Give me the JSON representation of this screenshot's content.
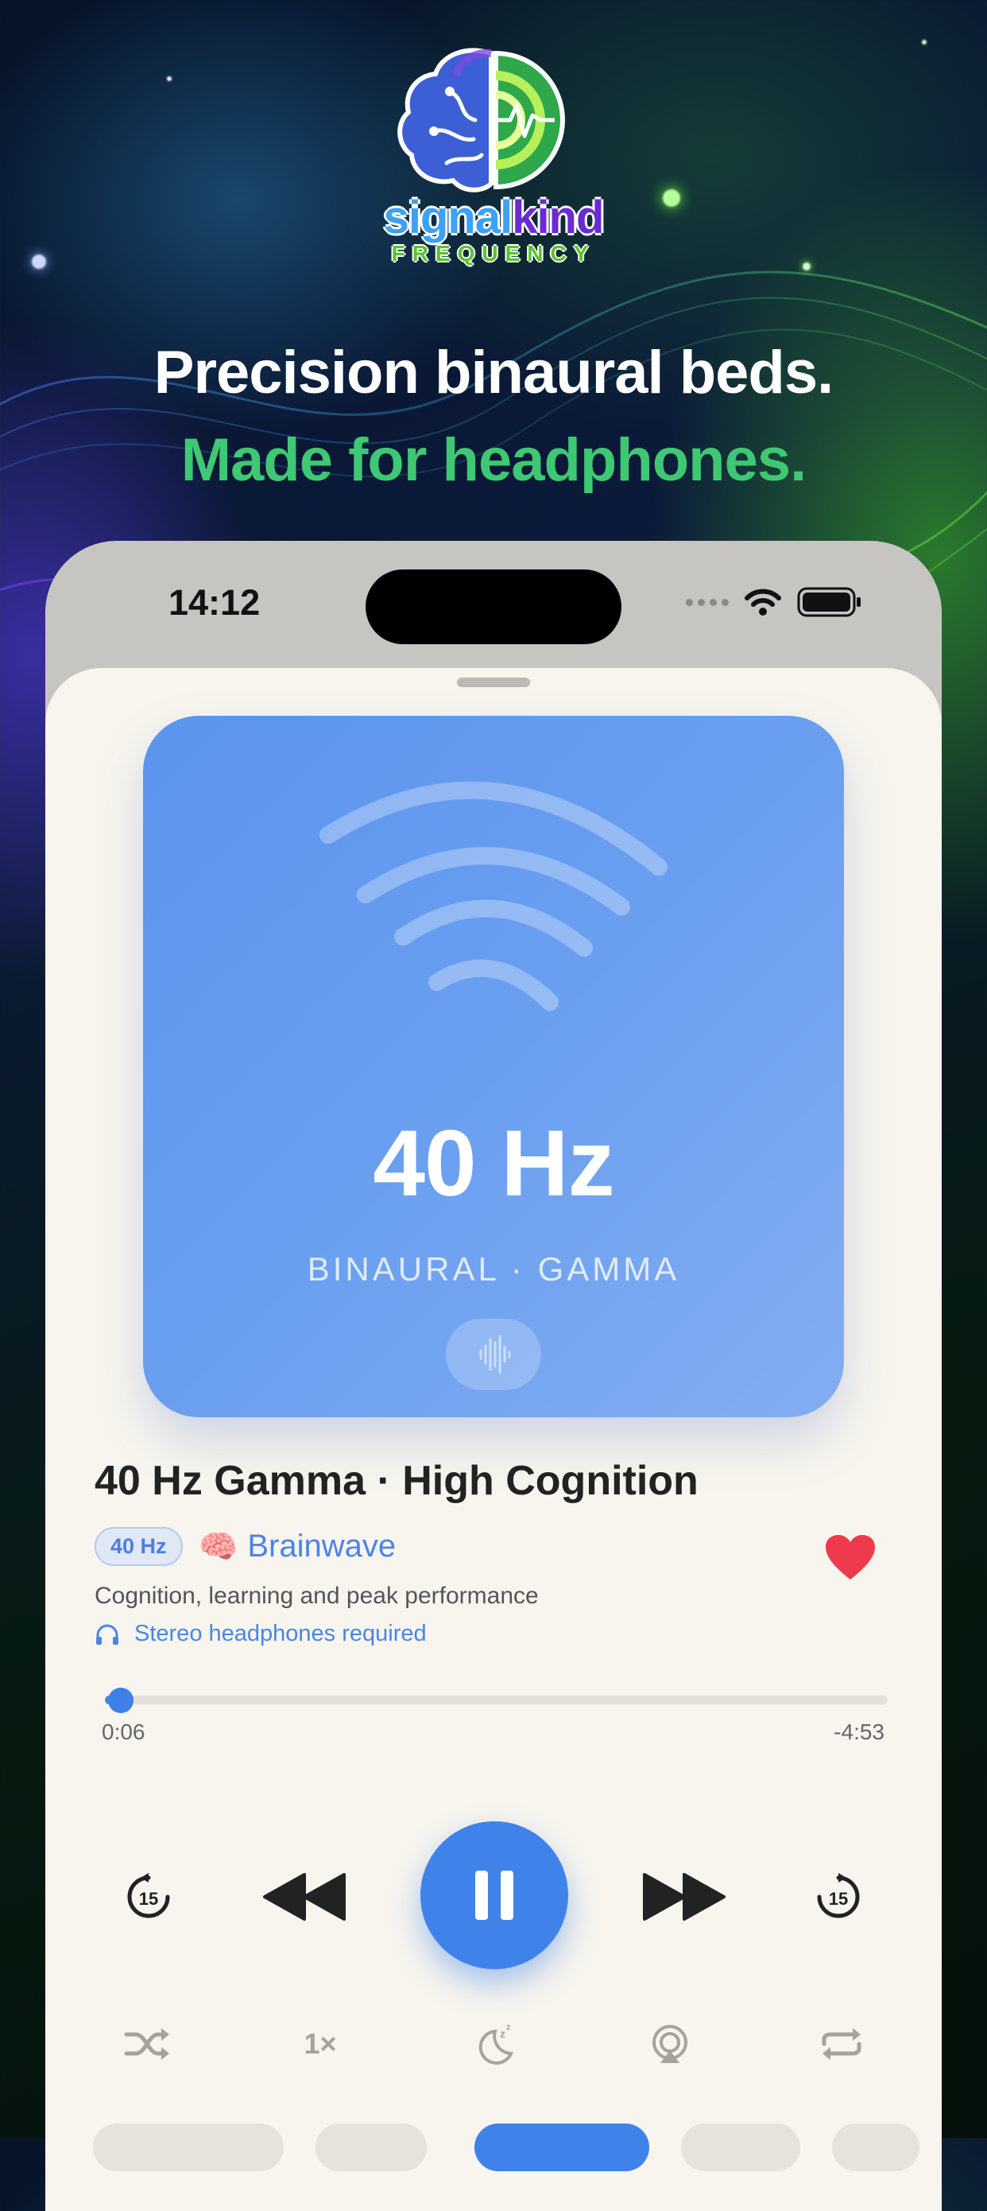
{
  "brand": {
    "name_part1": "signal",
    "name_part2": "kind",
    "subtitle": "FREQUENCY"
  },
  "headline": {
    "line1": "Precision binaural beds.",
    "line2": "Made for headphones."
  },
  "status_bar": {
    "time": "14:12"
  },
  "player": {
    "art": {
      "frequency": "40 Hz",
      "subtitle": "BINAURAL · GAMMA"
    },
    "track": {
      "title": "40 Hz Gamma · High Cognition",
      "hz_badge": "40 Hz",
      "category": "Brainwave",
      "category_emoji": "🧠",
      "description": "Cognition, learning and peak performance",
      "requirement": "Stereo headphones required",
      "favorite": true
    },
    "progress": {
      "elapsed": "0:06",
      "remaining": "-4:53",
      "fraction": 0.02
    },
    "controls": {
      "skip_back_seconds": "15",
      "skip_forward_seconds": "15",
      "state": "playing"
    },
    "secondary": {
      "speed_label": "1×"
    }
  },
  "colors": {
    "accent": "#3f82ea",
    "headline_green": "#3ec873",
    "heart": "#ee3a4c",
    "sheet_bg": "#f8f5ee"
  }
}
